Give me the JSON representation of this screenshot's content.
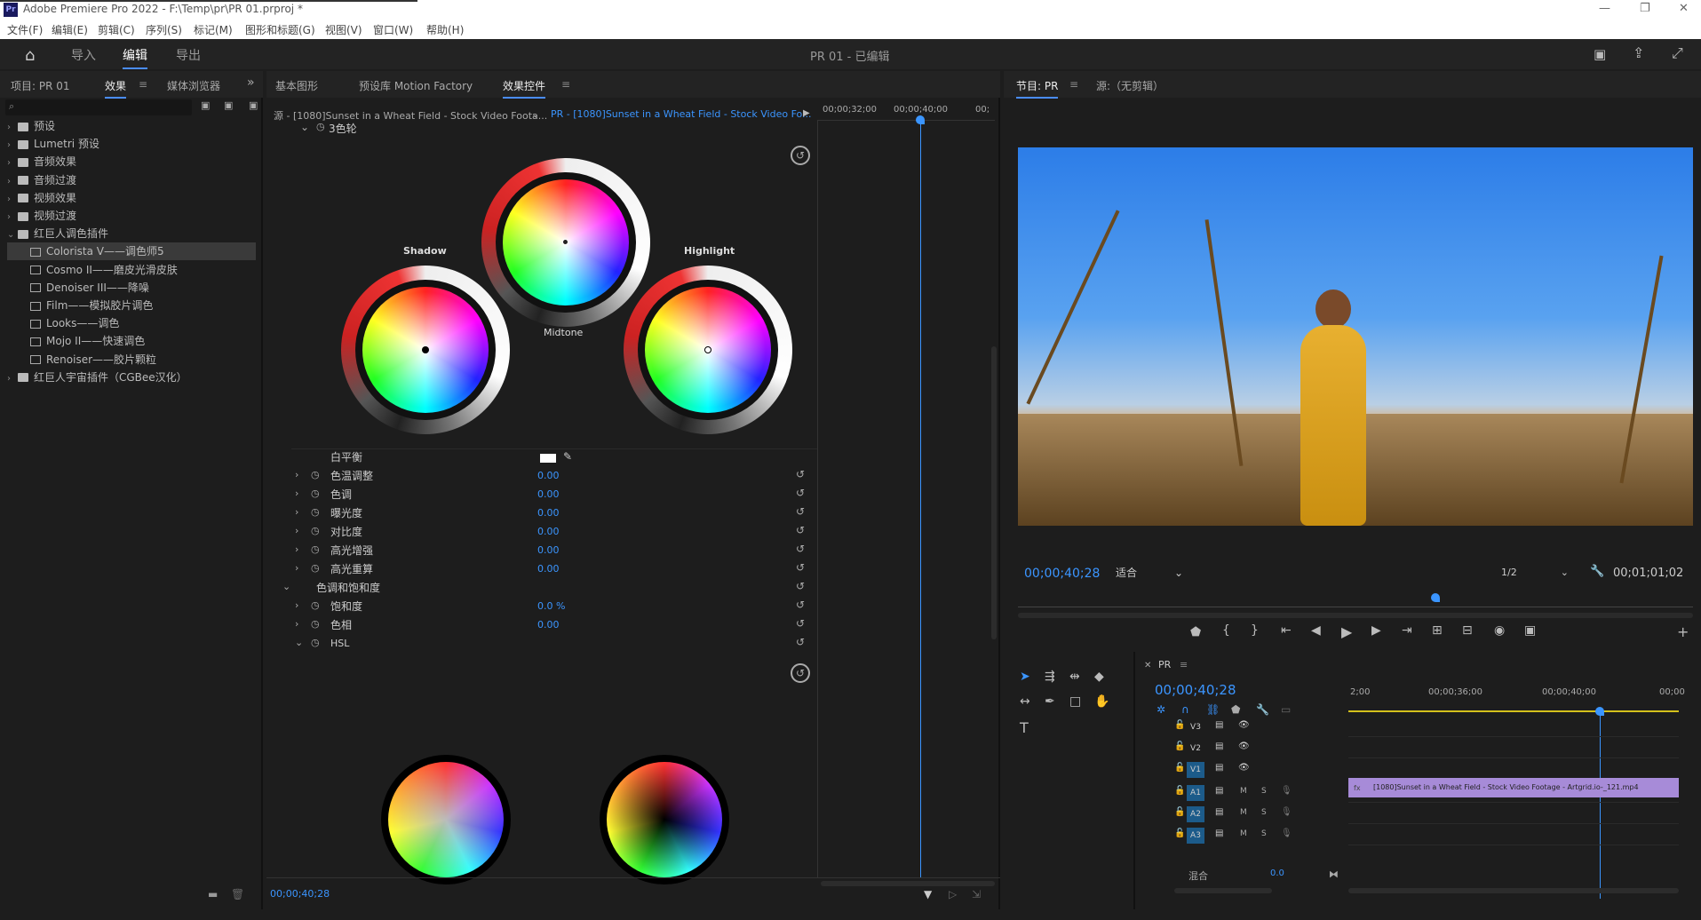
{
  "titlebar": {
    "title": "Adobe Premiere Pro 2022 - F:\\Temp\\pr\\PR 01.prproj *",
    "minimize": "—",
    "restore": "❐",
    "close": "✕"
  },
  "menubar": [
    "文件(F)",
    "编辑(E)",
    "剪辑(C)",
    "序列(S)",
    "标记(M)",
    "图形和标题(G)",
    "视图(V)",
    "窗口(W)",
    "帮助(H)"
  ],
  "topnav": {
    "import": "导入",
    "edit": "编辑",
    "export": "导出",
    "project_title": "PR 01 - 已编辑"
  },
  "left": {
    "tabs": [
      "项目: PR 01",
      "效果",
      "媒体浏览器"
    ],
    "tree": [
      {
        "label": "预设",
        "indent": 0,
        "type": "folder"
      },
      {
        "label": "Lumetri 预设",
        "indent": 0,
        "type": "folder"
      },
      {
        "label": "音频效果",
        "indent": 0,
        "type": "folder"
      },
      {
        "label": "音频过渡",
        "indent": 0,
        "type": "folder"
      },
      {
        "label": "视频效果",
        "indent": 0,
        "type": "folder"
      },
      {
        "label": "视频过渡",
        "indent": 0,
        "type": "folder"
      },
      {
        "label": "红巨人调色插件",
        "indent": 0,
        "type": "folder-open"
      },
      {
        "label": "Colorista V——调色师5",
        "indent": 1,
        "type": "fx",
        "selected": true
      },
      {
        "label": "Cosmo II——磨皮光滑皮肤",
        "indent": 1,
        "type": "fx"
      },
      {
        "label": "Denoiser III——降噪",
        "indent": 1,
        "type": "fx"
      },
      {
        "label": "Film——模拟胶片调色",
        "indent": 1,
        "type": "fx"
      },
      {
        "label": "Looks——调色",
        "indent": 1,
        "type": "fx"
      },
      {
        "label": "Mojo II——快速调色",
        "indent": 1,
        "type": "fx"
      },
      {
        "label": "Renoiser——胶片颗粒",
        "indent": 1,
        "type": "fx"
      },
      {
        "label": "红巨人宇宙插件（CGBee汉化）",
        "indent": 0,
        "type": "folder"
      }
    ]
  },
  "effects": {
    "tabs": [
      "基本图形",
      "预设库 Motion Factory",
      "效果控件"
    ],
    "source_label": "源 - [1080]Sunset in a Wheat Field - Stock Video Foota...",
    "clip_label": "PR - [1080]Sunset in a Wheat Field - Stock Video Fo...",
    "ruler": [
      "00;00;32;00",
      "00;00;40;00",
      "00;"
    ],
    "section": "3色轮",
    "wheels": {
      "shadow": "Shadow",
      "midtone": "Midtone",
      "highlight": "Highlight"
    },
    "props": [
      {
        "name": "白平衡",
        "value": ""
      },
      {
        "name": "色温调整",
        "value": "0.00"
      },
      {
        "name": "色调",
        "value": "0.00"
      },
      {
        "name": "曝光度",
        "value": "0.00"
      },
      {
        "name": "对比度",
        "value": "0.00"
      },
      {
        "name": "高光增强",
        "value": "0.00"
      },
      {
        "name": "高光重算",
        "value": "0.00"
      },
      {
        "name": "色调和饱和度",
        "value": ""
      },
      {
        "name": "饱和度",
        "value": "0.0 %"
      },
      {
        "name": "色相",
        "value": "0.00"
      },
      {
        "name": "HSL",
        "value": ""
      }
    ],
    "timecode": "00;00;40;28"
  },
  "program": {
    "tabs": [
      "节目: PR",
      "源:（无剪辑）"
    ],
    "timecode": "00;00;40;28",
    "fit": "适合",
    "ratio": "1/2",
    "duration": "00;01;01;02"
  },
  "timeline": {
    "name": "PR",
    "timecode": "00;00;40;28",
    "ruler": [
      "2;00",
      "00;00;36;00",
      "00;00;40;00",
      "00;00"
    ],
    "tracks": [
      {
        "id": "V3"
      },
      {
        "id": "V2"
      },
      {
        "id": "V1"
      },
      {
        "id": "A1"
      },
      {
        "id": "A2"
      },
      {
        "id": "A3"
      }
    ],
    "mix": "混合",
    "mix_val": "0.0",
    "clip": "[1080]Sunset in a Wheat Field - Stock Video Footage - Artgrid.io-_121.mp4"
  },
  "colors": {
    "accent": "#4a8dff",
    "clip": "#a78bd8",
    "value_blue": "#3b95ff"
  }
}
